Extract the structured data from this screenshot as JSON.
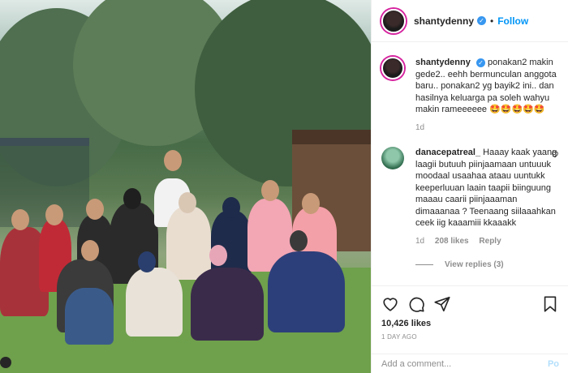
{
  "post": {
    "username": "shantydenny",
    "follow_label": "Follow",
    "dot": "•"
  },
  "caption": {
    "username": "shantydenny",
    "text": "ponakan2 makin gede2.. eehh bermunculan anggota baru.. ponakan2 yg bayik2 ini.. dan hasilnya keluarga pa soleh wahyu makin rameeeeee 🤩🤩🤩🤩🤩",
    "time": "1d"
  },
  "comment": {
    "username": "danacepatreal_",
    "text": "Haaay kaak yaang laagii butuuh piinjaamaan untuuuk moodaal usaahaa ataau uuntukk keeperluuan laain taapii biinguung maaau caarii piinjaaaman dimaaanaa ? Teenaang siilaaahkan ceek iig kaaamiii kkaaakk",
    "time": "1d",
    "likes": "208 likes",
    "reply": "Reply",
    "view_replies": "View replies (3)"
  },
  "stats": {
    "likes": "10,426 likes",
    "ago": "1 DAY AGO"
  },
  "composer": {
    "placeholder": "Add a comment...",
    "post_label": "Po"
  },
  "colors": {
    "accent": "#0095f6",
    "verified": "#3897f0",
    "muted": "#8e8e8e"
  },
  "icons": [
    "heart-icon",
    "comment-icon",
    "share-icon",
    "bookmark-icon",
    "verified-icon"
  ]
}
